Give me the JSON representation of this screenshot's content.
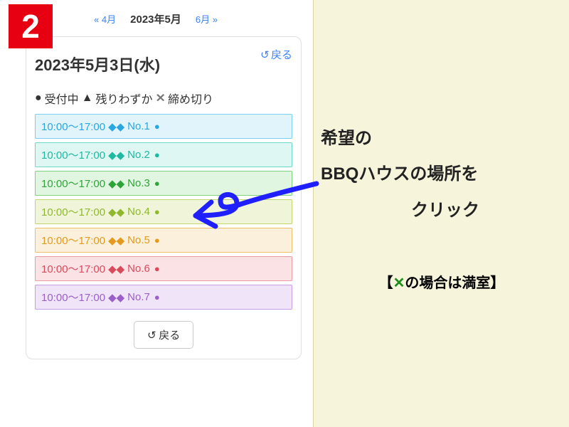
{
  "step_number": "2",
  "month_nav": {
    "prev": "4月",
    "prev_chev": "«",
    "current": "2023年5月",
    "next": "6月",
    "next_chev": "»"
  },
  "card": {
    "date_heading": "2023年5月3日(水)",
    "back_label": "戻る"
  },
  "legend": {
    "accepting": "受付中",
    "few": "残りわずか",
    "closed": "締め切り"
  },
  "slots": [
    {
      "time": "10:00～17:00",
      "marks": "◆◆",
      "name": "No.1",
      "color": "#2aa7e0",
      "bg": "#e1f3fb",
      "border": "#7bcff0"
    },
    {
      "time": "10:00～17:00",
      "marks": "◆◆",
      "name": "No.2",
      "color": "#1fb8a0",
      "bg": "#dff7f2",
      "border": "#6bd9c3"
    },
    {
      "time": "10:00～17:00",
      "marks": "◆◆",
      "name": "No.3",
      "color": "#2fa33a",
      "bg": "#e1f6e1",
      "border": "#7fd27f"
    },
    {
      "time": "10:00～17:00",
      "marks": "◆◆",
      "name": "No.4",
      "color": "#8fb82e",
      "bg": "#f0f5da",
      "border": "#bfd76d"
    },
    {
      "time": "10:00～17:00",
      "marks": "◆◆",
      "name": "No.5",
      "color": "#e29a1f",
      "bg": "#fbf0db",
      "border": "#edc06a"
    },
    {
      "time": "10:00～17:00",
      "marks": "◆◆",
      "name": "No.6",
      "color": "#d94a5c",
      "bg": "#fbe2e4",
      "border": "#eb9aa3"
    },
    {
      "time": "10:00～17:00",
      "marks": "◆◆",
      "name": "No.7",
      "color": "#9a5fc8",
      "bg": "#f0e4f8",
      "border": "#c59ee3"
    }
  ],
  "instruction": {
    "line1": "希望の",
    "line2": "BBQハウスの場所を",
    "line3": "クリック"
  },
  "footnote": {
    "open": "【",
    "x": "✕",
    "rest": "の場合は満室】"
  }
}
